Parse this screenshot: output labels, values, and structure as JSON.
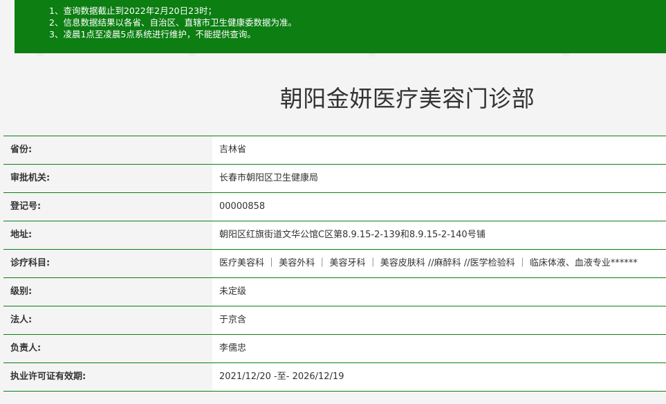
{
  "notice": {
    "lines": [
      "1、查询数据截止到2022年2月20日23时；",
      "2、信息数据结果以各省、自治区、直辖市卫生健康委数据为准。",
      "3、凌晨1点至凌晨5点系统进行维护，不能提供查询。"
    ]
  },
  "title": "朝阳金妍医疗美容门诊部",
  "rows": [
    {
      "label": "省份:",
      "value": "吉林省"
    },
    {
      "label": "审批机关:",
      "value": "长春市朝阳区卫生健康局"
    },
    {
      "label": "登记号:",
      "value": "00000858"
    },
    {
      "label": "地址:",
      "value": "朝阳区红旗街道文华公馆C区第8.9.15-2-139和8.9.15-2-140号铺"
    },
    {
      "label": "诊疗科目:",
      "value": "医疗美容科 ｜ 美容外科 ｜ 美容牙科 ｜ 美容皮肤科 //麻醉科 //医学检验科 ｜ 临床体液、血液专业******"
    },
    {
      "label": "级别:",
      "value": "未定级"
    },
    {
      "label": "法人:",
      "value": "于京含"
    },
    {
      "label": "负责人:",
      "value": "李儒忠"
    },
    {
      "label": "执业许可证有效期:",
      "value": "2021/12/20 -至- 2026/12/19"
    }
  ],
  "colors": {
    "accent": "#0c7e12",
    "background": "#f4f4f4",
    "value_bg": "#ffffff"
  }
}
